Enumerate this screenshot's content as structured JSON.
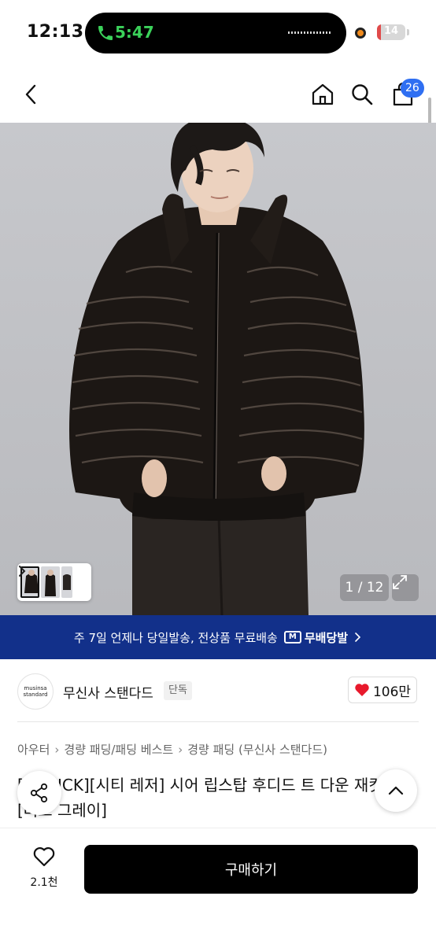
{
  "status_bar": {
    "time": "12:13",
    "call_time": "5:47",
    "battery": "14",
    "battery_level_percent": 14
  },
  "nav": {
    "cart_count": "26"
  },
  "gallery": {
    "page_indicator": "1 / 12",
    "current_page": 1,
    "total_pages": 12
  },
  "banner": {
    "text": "주 7일 언제나 당일발송, 전상품 무료배송",
    "badge": "무배당발",
    "badge_box": "M"
  },
  "brand": {
    "logo_line1": "musinsa",
    "logo_line2": "standard",
    "name": "무신사 스탠다드",
    "tag": "단독",
    "like_count": "106만"
  },
  "breadcrumb": [
    "아우터",
    "경량 패딩/패딩 베스트",
    "경량 패딩 (무신사 스탠다드)"
  ],
  "product": {
    "title": "[ 현 PICK][시티 레저] 시어 립스탑 후디드 트 다운 재킷 [머드 그레이]"
  },
  "bottom": {
    "wish_count": "2.1천",
    "buy_label": "구매하기"
  },
  "colors": {
    "banner_bg": "#12308a",
    "badge_blue": "#2f6ff2",
    "call_green": "#3bd25a",
    "heart_red": "#e8192c"
  }
}
